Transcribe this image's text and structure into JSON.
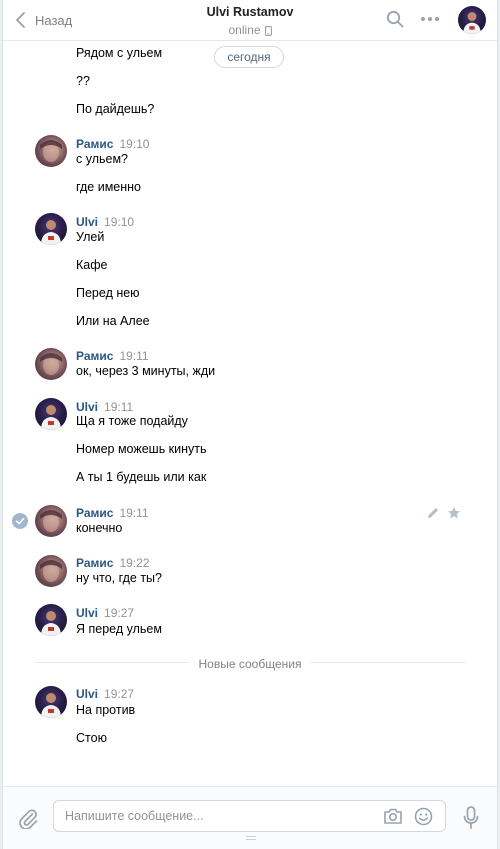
{
  "header": {
    "back_label": "Назад",
    "title": "Ulvi Rustamov",
    "status": "online"
  },
  "date_pill": "сегодня",
  "messages": [
    {
      "text": "Рядом с ульем"
    },
    {
      "text": "??"
    },
    {
      "text": "По дайдешь?"
    },
    {
      "author": "Рамис",
      "time": "19:10",
      "text": "с ульем?"
    },
    {
      "text": "где именно"
    },
    {
      "author": "Ulvi",
      "time": "19:10",
      "text": "Улей"
    },
    {
      "text": "Кафе"
    },
    {
      "text": "Перед нею"
    },
    {
      "text": "Или на Алее"
    },
    {
      "author": "Рамис",
      "time": "19:11",
      "text": "ок, через 3 минуты, жди"
    },
    {
      "author": "Ulvi",
      "time": "19:11",
      "text": "Ща я тоже подайду"
    },
    {
      "text": "Номер можешь кинуть"
    },
    {
      "text": "А ты 1 будешь или как"
    },
    {
      "author": "Рамис",
      "time": "19:11",
      "text": "конечно"
    },
    {
      "author": "Рамис",
      "time": "19:22",
      "text": "ну что, где ты?"
    },
    {
      "author": "Ulvi",
      "time": "19:27",
      "text": "Я перед ульем"
    },
    {
      "author": "Ulvi",
      "time": "19:27",
      "text": "На против"
    },
    {
      "text": "Стою"
    }
  ],
  "new_messages_divider": "Новые сообщения",
  "composer": {
    "placeholder": "Напишите сообщение..."
  },
  "colors": {
    "author_name": "#2a5885",
    "time": "#939393",
    "icon": "#99a2ad"
  }
}
